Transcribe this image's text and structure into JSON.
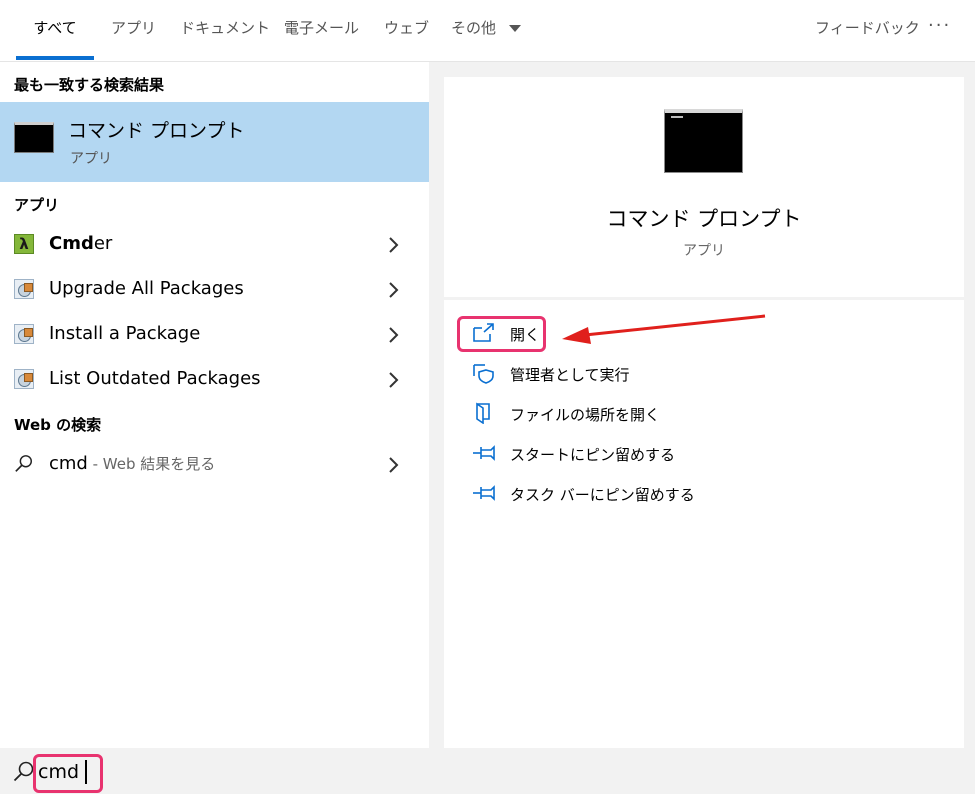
{
  "tabs": [
    {
      "label": "すべて",
      "active": true
    },
    {
      "label": "アプリ"
    },
    {
      "label": "ドキュメント"
    },
    {
      "label": "電子メール"
    },
    {
      "label": "ウェブ"
    },
    {
      "label": "その他"
    }
  ],
  "header": {
    "feedback": "フィードバック",
    "more": "···"
  },
  "results": {
    "best_match_heading": "最も一致する検索結果",
    "best_match": {
      "title": "コマンド プロンプト",
      "subtitle": "アプリ",
      "icon": "command-prompt-icon"
    },
    "apps_heading": "アプリ",
    "apps": [
      {
        "bold": "Cmd",
        "rest": "er",
        "icon": "cmder-lambda-icon"
      },
      {
        "label": "Upgrade All Packages",
        "icon": "package-icon"
      },
      {
        "label": "Install a Package",
        "icon": "package-icon"
      },
      {
        "label": "List Outdated Packages",
        "icon": "package-icon"
      }
    ],
    "web_heading": "Web の検索",
    "web": {
      "query": "cmd",
      "suffix": " - Web 結果を見る"
    }
  },
  "detail": {
    "title": "コマンド プロンプト",
    "subtitle": "アプリ",
    "actions": [
      {
        "label": "開く",
        "icon": "open-icon"
      },
      {
        "label": "管理者として実行",
        "icon": "shield-icon"
      },
      {
        "label": "ファイルの場所を開く",
        "icon": "file-location-icon"
      },
      {
        "label": "スタートにピン留めする",
        "icon": "pin-icon"
      },
      {
        "label": "タスク バーにピン留めする",
        "icon": "pin-icon"
      }
    ]
  },
  "search": {
    "value": "cmd"
  },
  "colors": {
    "accent": "#0a6fd1",
    "selected_bg": "#b3d7f2",
    "highlight": "#e8336f",
    "arrow": "#e0201c"
  }
}
